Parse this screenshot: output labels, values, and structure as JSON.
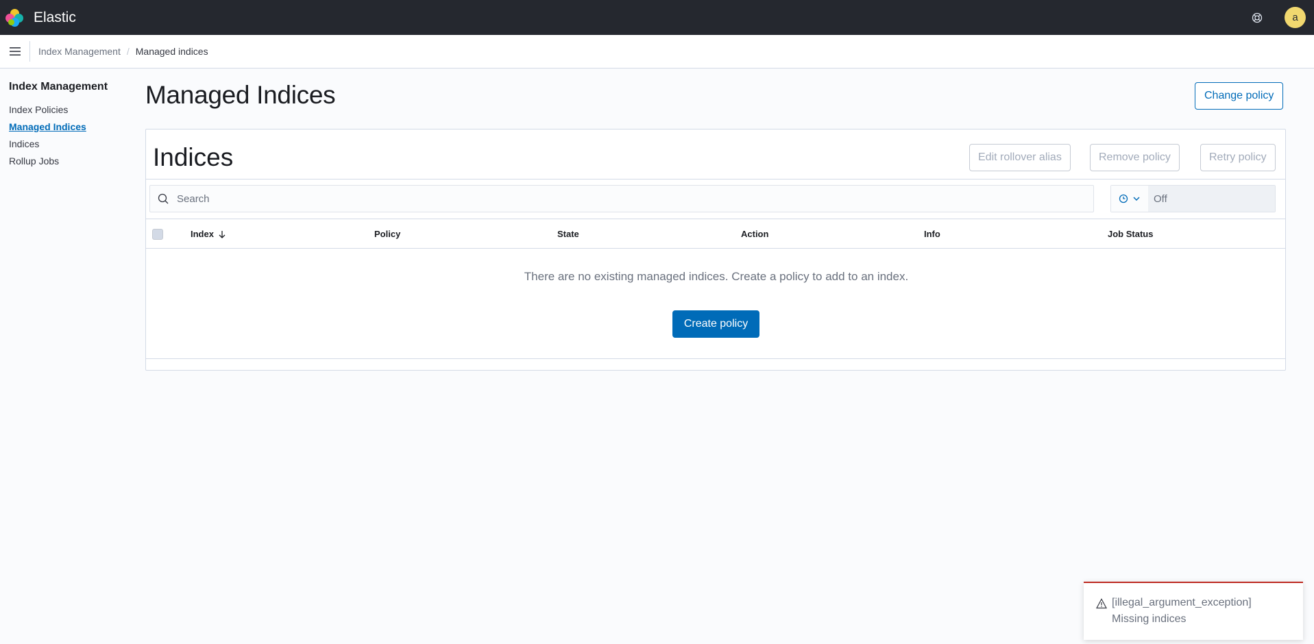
{
  "header": {
    "brand": "Elastic",
    "avatar_initial": "a"
  },
  "breadcrumbs": {
    "items": [
      "Index Management",
      "Managed indices"
    ]
  },
  "sidebar": {
    "title": "Index Management",
    "items": [
      {
        "label": "Index Policies"
      },
      {
        "label": "Managed Indices"
      },
      {
        "label": "Indices"
      },
      {
        "label": "Rollup Jobs"
      }
    ]
  },
  "main": {
    "title": "Managed Indices",
    "change_policy_label": "Change policy",
    "panel": {
      "title": "Indices",
      "actions": [
        "Edit rollover alias",
        "Remove policy",
        "Retry policy"
      ],
      "search_placeholder": "Search",
      "refresh_value": "Off",
      "columns": [
        "Index",
        "Policy",
        "State",
        "Action",
        "Info",
        "Job Status"
      ],
      "empty_message": "There are no existing managed indices. Create a policy to add to an index.",
      "create_policy_label": "Create policy"
    }
  },
  "toast": {
    "title": "[illegal_argument_exception]",
    "body": "Missing indices"
  },
  "colors": {
    "accent": "#006bb8",
    "header_bg": "#25282f",
    "danger": "#bd271e",
    "avatar": "#f1d86f"
  },
  "icons": {
    "menu": "hamburger-menu-icon",
    "help": "help-icon",
    "search": "search-icon",
    "clock": "clock-icon",
    "sort": "arrow-down-icon",
    "warning": "warning-icon"
  }
}
